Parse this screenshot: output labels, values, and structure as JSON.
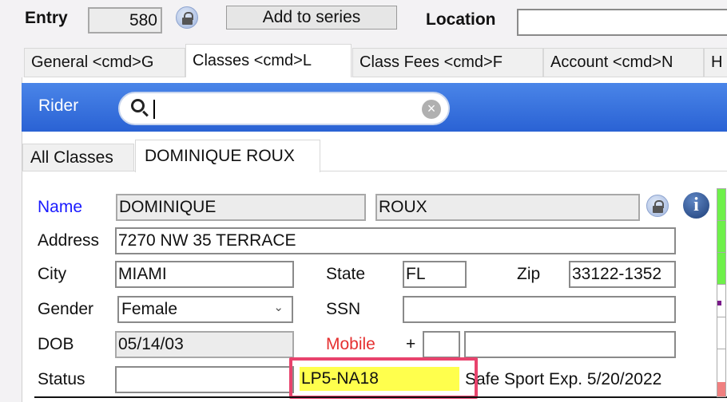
{
  "header": {
    "entry_label": "Entry",
    "entry_value": "580",
    "add_to_series": "Add to series",
    "location_label": "Location",
    "location_value": ""
  },
  "tabs": [
    {
      "label": "General <cmd>G"
    },
    {
      "label": "Classes <cmd>L",
      "active": true
    },
    {
      "label": "Class Fees <cmd>F"
    },
    {
      "label": "Account <cmd>N"
    },
    {
      "label": "H"
    }
  ],
  "rider_bar": {
    "label": "Rider",
    "search_value": "",
    "color": "#2d6ad8"
  },
  "subtabs": [
    {
      "label": "All Classes"
    },
    {
      "label": "DOMINIQUE ROUX",
      "active": true
    }
  ],
  "form": {
    "name_label": "Name",
    "first_name": "DOMINIQUE",
    "last_name": "ROUX",
    "address_label": "Address",
    "address": "7270 NW 35 TERRACE",
    "city_label": "City",
    "city": "MIAMI",
    "state_label": "State",
    "state": "FL",
    "zip_label": "Zip",
    "zip": "33122-1352",
    "gender_label": "Gender",
    "gender": "Female",
    "ssn_label": "SSN",
    "ssn": "",
    "dob_label": "DOB",
    "dob": "05/14/03",
    "mobile_label": "Mobile",
    "mobile_plus": "+",
    "mobile_code": "",
    "mobile_number": "",
    "status_label": "Status",
    "status": "",
    "membership": "LP5-NA18",
    "safe_sport": "Safe Sport Exp. 5/20/2022"
  },
  "colors": {
    "highlight": "#ffff4d",
    "annotation_border": "#e8436d",
    "name_label": "#1a1aff",
    "mobile_label": "#e53030",
    "status_green": "#6ef04a",
    "status_pink": "#f08080"
  }
}
